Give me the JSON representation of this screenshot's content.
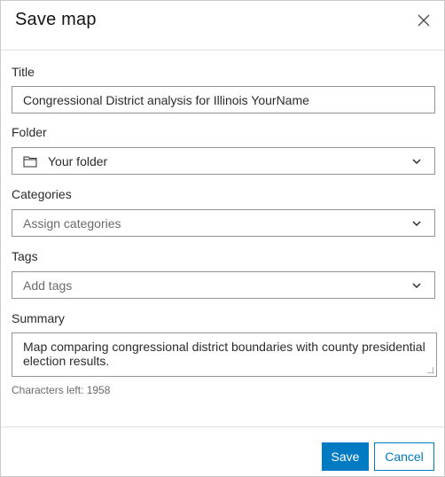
{
  "dialog": {
    "title": "Save map",
    "close_icon": "close-icon"
  },
  "form": {
    "title_label": "Title",
    "title_value": "Congressional District analysis for Illinois YourName",
    "folder_label": "Folder",
    "folder_value": "Your folder",
    "folder_icon": "folder-icon",
    "categories_label": "Categories",
    "categories_placeholder": "Assign categories",
    "tags_label": "Tags",
    "tags_placeholder": "Add tags",
    "summary_label": "Summary",
    "summary_value": "Map comparing congressional district boundaries with county presidential election results.",
    "characters_left": "Characters left: 1958"
  },
  "footer": {
    "save_label": "Save",
    "cancel_label": "Cancel"
  },
  "colors": {
    "accent": "#007ac2",
    "border": "#949494",
    "text": "#2b2b2b",
    "placeholder": "#6a6a6a"
  }
}
